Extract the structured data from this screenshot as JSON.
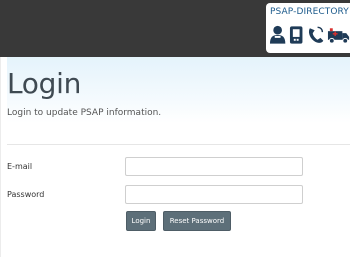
{
  "header": {
    "logo_text": "PSAP-DIRECTORY",
    "logo_icons": [
      "person-icon",
      "phone-icon",
      "telephone-icon",
      "ambulance-icon"
    ]
  },
  "hero": {
    "title": "Login",
    "subtitle": "Login to update PSAP information."
  },
  "form": {
    "email_label": "E-mail",
    "email_value": "",
    "password_label": "Password",
    "password_value": "",
    "login_button": "Login",
    "reset_button": "Reset Password"
  },
  "colors": {
    "header_bg": "#393939",
    "button_bg": "#5d6f79",
    "hero_gradient_top": "#e4f3fb",
    "logo_text": "#1d5b8c",
    "accent_red": "#d9302e"
  }
}
